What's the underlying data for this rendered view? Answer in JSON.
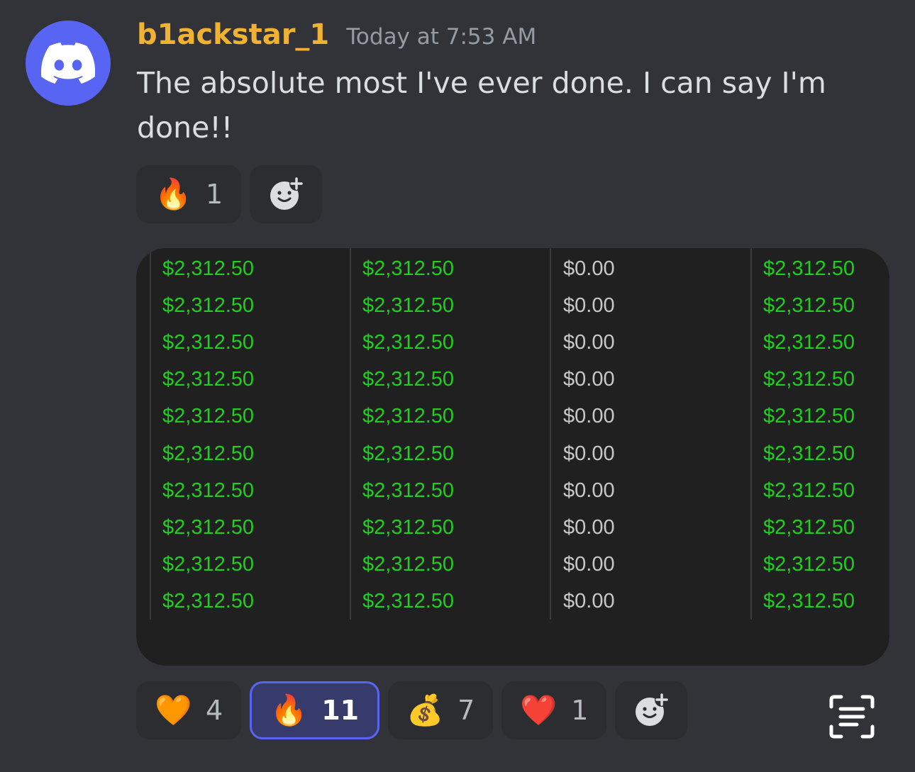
{
  "message": {
    "username": "b1ackstar_1",
    "timestamp": "Today at 7:53 AM",
    "text": "The absolute most I've ever done. I can say I'm done!!",
    "avatar_icon": "discord-logo-icon",
    "colors": {
      "username": "#f0b232",
      "avatar_bg": "#5865f2",
      "background": "#313338"
    }
  },
  "text_reactions": [
    {
      "emoji": "🔥",
      "count": "1",
      "active": false
    }
  ],
  "image_reactions": [
    {
      "emoji": "🧡",
      "count": "4",
      "active": false
    },
    {
      "emoji": "🔥",
      "count": "11",
      "active": true
    },
    {
      "emoji": "💰",
      "count": "7",
      "active": false
    },
    {
      "emoji": "❤️",
      "count": "1",
      "active": false
    }
  ],
  "add_reaction_icon": "add-reaction-icon",
  "scan_icon": "text-scan-icon",
  "table": {
    "columns": [
      {
        "values": [
          "$2,312.50",
          "$2,312.50",
          "$2,312.50",
          "$2,312.50",
          "$2,312.50",
          "$2,312.50",
          "$2,312.50",
          "$2,312.50",
          "$2,312.50",
          "$2,312.50"
        ],
        "color": "green"
      },
      {
        "values": [
          "$2,312.50",
          "$2,312.50",
          "$2,312.50",
          "$2,312.50",
          "$2,312.50",
          "$2,312.50",
          "$2,312.50",
          "$2,312.50",
          "$2,312.50",
          "$2,312.50"
        ],
        "color": "green"
      },
      {
        "values": [
          "$0.00",
          "$0.00",
          "$0.00",
          "$0.00",
          "$0.00",
          "$0.00",
          "$0.00",
          "$0.00",
          "$0.00",
          "$0.00"
        ],
        "color": "gray"
      },
      {
        "values": [
          "$2,312.50",
          "$2,312.50",
          "$2,312.50",
          "$2,312.50",
          "$2,312.50",
          "$2,312.50",
          "$2,312.50",
          "$2,312.50",
          "$2,312.50",
          "$2,312.50"
        ],
        "color": "green"
      }
    ]
  }
}
